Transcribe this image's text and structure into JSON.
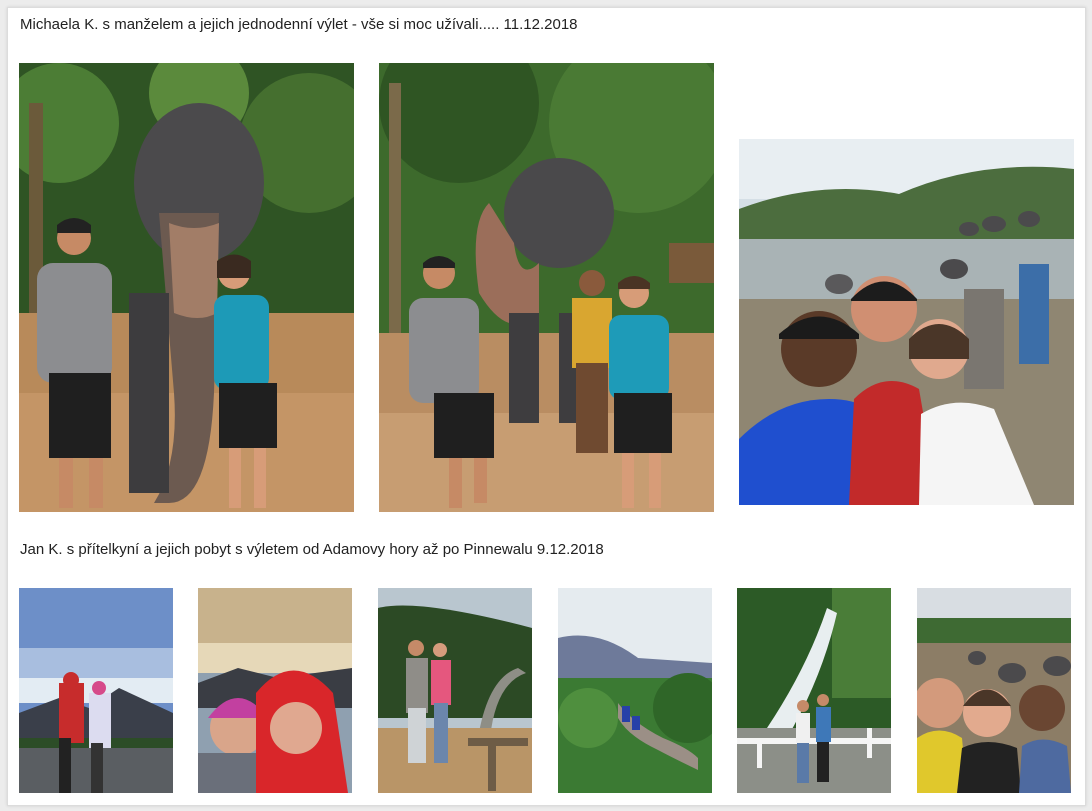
{
  "sections": [
    {
      "caption": "Michaela K. s manželem a jejich jednodenní výlet - vše si moc užívali..... 11.12.2018",
      "photos": [
        "elephant-photo",
        "elephant-photo",
        "river-selfie-photo"
      ]
    },
    {
      "caption": "Jan K. s přítelkyní a jejich pobyt s výletem od Adamovy hory až po Pinnewalu 9.12.2018",
      "photos": [
        "mountain-photo",
        "hood-selfie-photo",
        "viewpoint-photo",
        "train-bridge-photo",
        "waterfall-photo",
        "elephant-selfie-photo"
      ]
    }
  ],
  "colors": {
    "page_background": "#ececec",
    "card_background": "#ffffff",
    "caption_text": "#222222"
  }
}
